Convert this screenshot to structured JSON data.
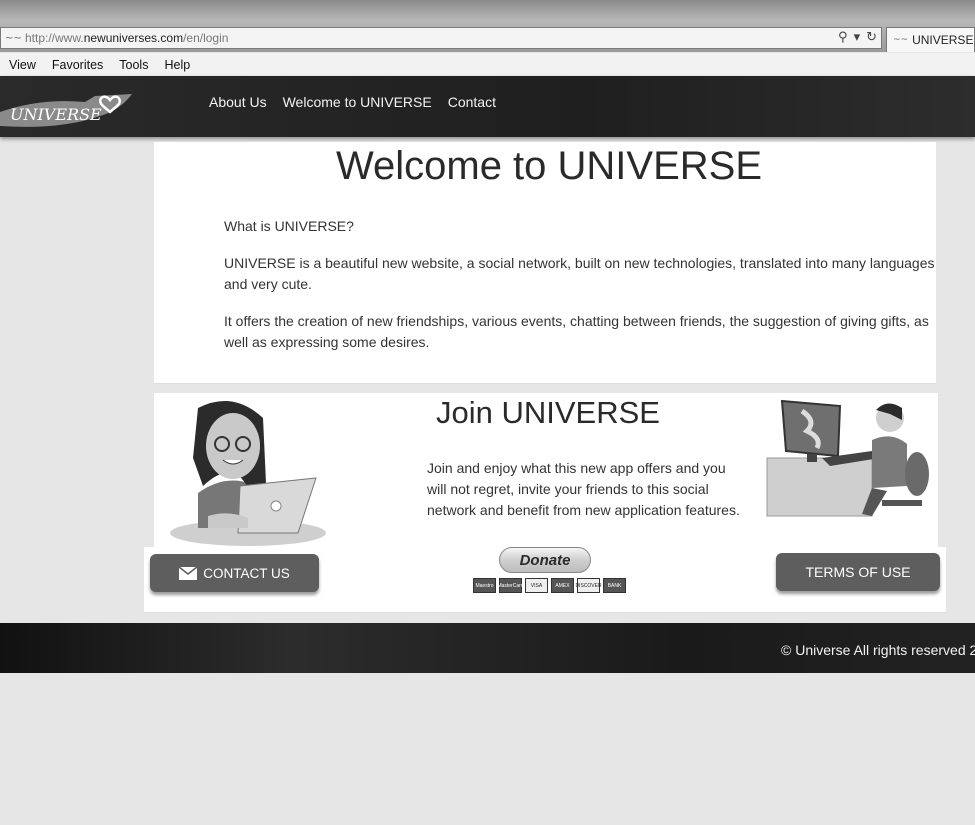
{
  "browser": {
    "url_prefix": "http://www.",
    "url_domain": "newuniverses.com",
    "url_path": "/en/login",
    "tab_title": "UNIVERSE",
    "menu": [
      "View",
      "Favorites",
      "Tools",
      "Help"
    ]
  },
  "nav": {
    "logo_text": "UNIVERSE",
    "links": [
      "About Us",
      "Welcome to UNIVERSE",
      "Contact"
    ]
  },
  "welcome": {
    "title": "Welcome to UNIVERSE",
    "question": "What is UNIVERSE?",
    "paragraph1": "UNIVERSE is a beautiful new website, a social network, built on new technologies, translated into many languages and very cute.",
    "paragraph2": "It offers the creation of new friendships, various events, chatting between friends, the suggestion of giving gifts, as well as expressing some desires."
  },
  "join": {
    "title": "Join UNIVERSE",
    "text": "Join and enjoy what this new app offers and you will not regret, invite your friends to this social network and benefit from new application features."
  },
  "actions": {
    "contact_label": "CONTACT US",
    "donate_label": "Donate",
    "terms_label": "TERMS OF USE",
    "card_logos": [
      "Maestro",
      "MasterCard",
      "VISA",
      "AMEX",
      "DISCOVER",
      "BANK"
    ]
  },
  "footer": {
    "copyright": "© Universe All rights reserved 2"
  }
}
